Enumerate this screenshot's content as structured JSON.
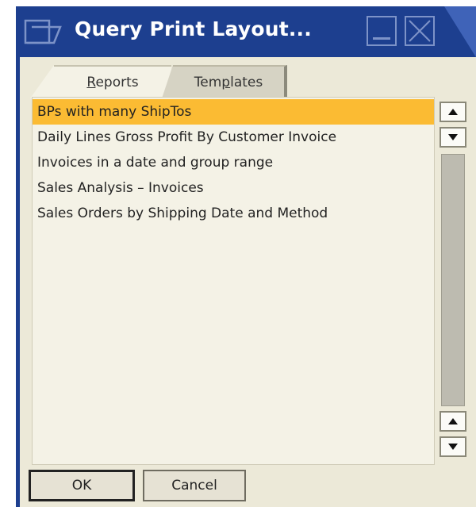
{
  "window": {
    "title": "Query Print Layout..."
  },
  "icons": {
    "window_icon": "folder-form-icon",
    "minimize": "minimize-icon",
    "close": "close-icon",
    "scroll_up": "triangle-up-icon",
    "scroll_down": "triangle-down-icon"
  },
  "tabs": [
    {
      "label_prefix": "",
      "label_accel": "R",
      "label_rest": "eports",
      "active": true
    },
    {
      "label_prefix": "Tem",
      "label_accel": "p",
      "label_rest": "lates",
      "active": false
    }
  ],
  "list": {
    "items": [
      {
        "label": "BPs with many ShipTos",
        "selected": true
      },
      {
        "label": "Daily Lines Gross Profit By Customer Invoice",
        "selected": false
      },
      {
        "label": "Invoices in a date and group range",
        "selected": false
      },
      {
        "label": "Sales Analysis – Invoices",
        "selected": false
      },
      {
        "label": "Sales Orders by Shipping Date and Method",
        "selected": false
      }
    ]
  },
  "buttons": {
    "ok": "OK",
    "cancel": "Cancel"
  },
  "colors": {
    "title_bar": "#1d3f8f",
    "selection": "#fbbb33",
    "window_bg": "#ece9d8"
  }
}
